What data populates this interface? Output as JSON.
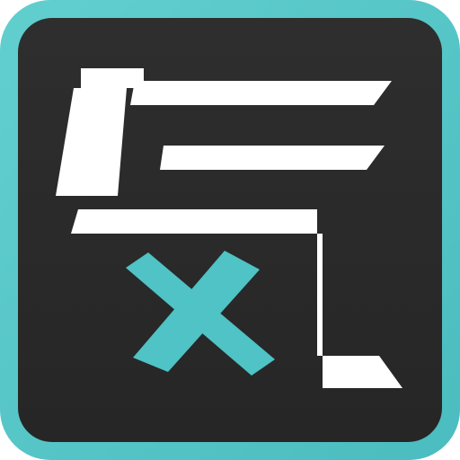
{
  "icon": {
    "semantic": "ki-kanji-logo-icon",
    "glyph": "気",
    "colors": {
      "border": "#5cc8c8",
      "background": "#2a2a2a",
      "glyph": "#ffffff",
      "accent": "#4fc3c5"
    }
  }
}
